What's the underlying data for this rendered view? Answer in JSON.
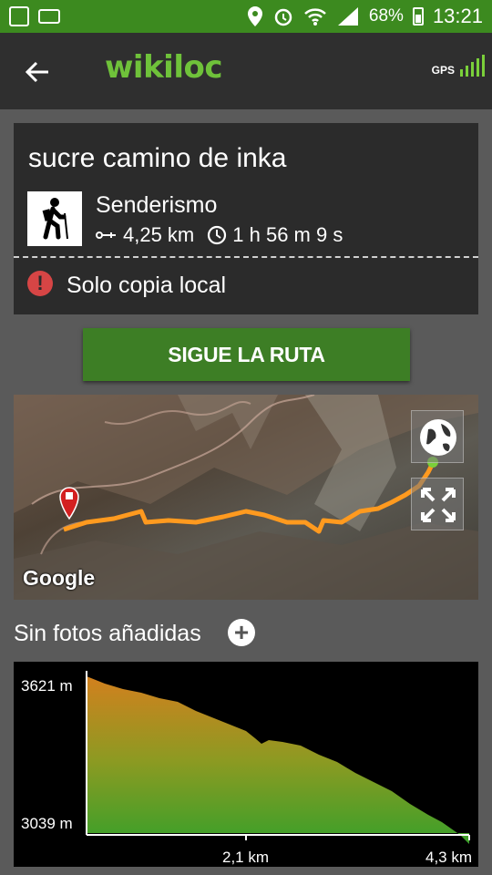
{
  "status_bar": {
    "battery": "68%",
    "time": "13:21",
    "icons": [
      "gps-app-icon",
      "voicemail-icon",
      "location-icon",
      "alarm-icon",
      "wifi-icon",
      "signal-icon",
      "battery-icon"
    ]
  },
  "app_bar": {
    "logo": "wikiloc",
    "gps_label": "GPS"
  },
  "route": {
    "title": "sucre camino de inka",
    "activity": "Senderismo",
    "distance": "4,25 km",
    "duration": "1 h 56 m 9 s",
    "warning": "Solo copia local"
  },
  "follow_button": "SIGUE LA RUTA",
  "map": {
    "attribution": "Google"
  },
  "photos": {
    "label": "Sin fotos añadidas"
  },
  "elevation": {
    "y_max_label": "3621 m",
    "y_min_label": "3039 m",
    "x_mid_label": "2,1 km",
    "x_max_label": "4,3 km"
  },
  "colors": {
    "status_bar": "#3c8a1f",
    "app_bar": "#2f2f2f",
    "brand_green": "#6fc23a",
    "button_green": "#3d7e25",
    "track_orange": "#ff9a1f",
    "warning_red": "#d64545"
  }
}
